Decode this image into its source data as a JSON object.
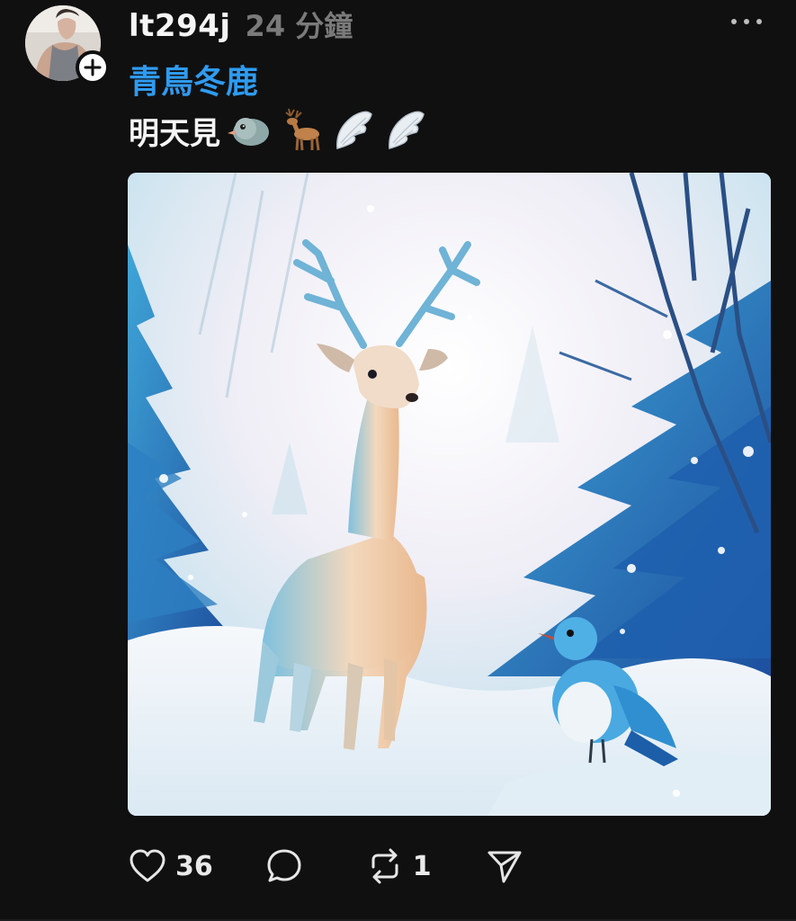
{
  "post": {
    "username": "lt294j",
    "timestamp": "24 分鐘",
    "tag": "青鳥冬鹿",
    "caption_text": "明天見",
    "caption_emojis": [
      "bird-emoji",
      "deer-emoji",
      "wing-emoji",
      "wing-emoji"
    ],
    "image_description_icon": "watercolor-deer-and-bluebird-image"
  },
  "actions": {
    "likes": "36",
    "replies": "",
    "reposts": "1"
  },
  "colors": {
    "background": "#101011",
    "tag_link": "#2f9bf0",
    "timestamp": "#7a7a7a"
  }
}
